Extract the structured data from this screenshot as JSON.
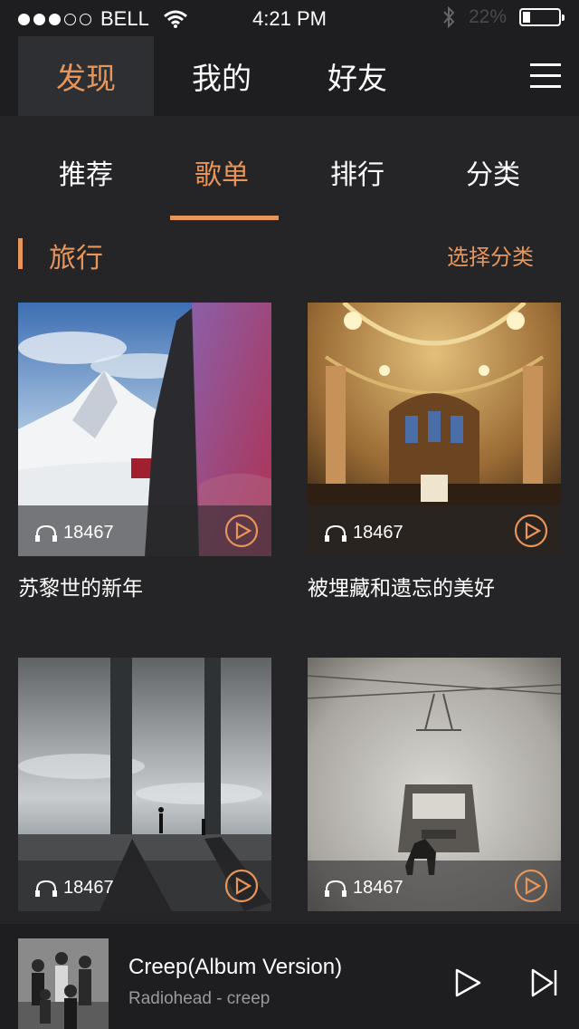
{
  "status": {
    "carrier": "BELL",
    "time": "4:21 PM",
    "battery_pct": "22%",
    "battery_level": 0.22
  },
  "top_tabs": [
    "发现",
    "我的",
    "好友"
  ],
  "sub_tabs": [
    "推荐",
    "歌单",
    "排行",
    "分类"
  ],
  "section": {
    "title": "旅行",
    "action": "选择分类"
  },
  "playlists": [
    {
      "title": "苏黎世的新年",
      "plays": "18467"
    },
    {
      "title": "被埋藏和遗忘的美好",
      "plays": "18467"
    },
    {
      "title": "",
      "plays": "18467"
    },
    {
      "title": "",
      "plays": "18467"
    }
  ],
  "player": {
    "song": "Creep(Album Version)",
    "artist": "Radiohead - creep"
  },
  "colors": {
    "accent": "#e8955a",
    "bg": "#252527",
    "bar": "#1e1e20"
  }
}
